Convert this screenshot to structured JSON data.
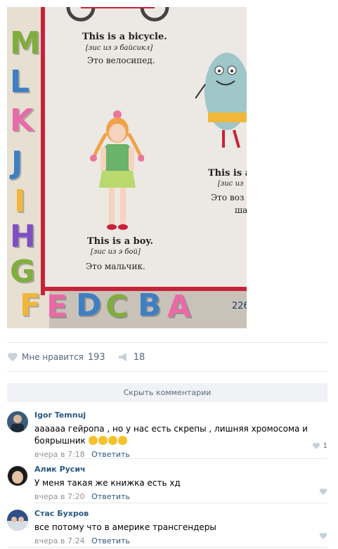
{
  "photo": {
    "caption_top_en": "This is a bicycle.",
    "caption_top_tr": "[зис из э байсикл]",
    "caption_top_ru": "Это велосипед.",
    "caption_mid_en": "This is a boy.",
    "caption_mid_tr": "[зис из э бой]",
    "caption_mid_ru": "Это мальчик.",
    "caption_right_en": "This is a",
    "caption_right_tr": "[зис из",
    "caption_right_ru1": "Это воз",
    "caption_right_ru2": "ша",
    "page_number": "226",
    "letters_left": [
      "M",
      "L",
      "K",
      "J",
      "I",
      "H",
      "G"
    ],
    "letters_bottom": [
      "F",
      "E",
      "D",
      "C",
      "B",
      "A"
    ]
  },
  "actions": {
    "like_label": "Мне нравится",
    "like_count": "193",
    "share_count": "18"
  },
  "hide_comments": "Скрыть комментарии",
  "comments": [
    {
      "author": "Igor Temnuj",
      "text": "аааааа гейропа , но у нас есть скрепы , лишняя хромосома и боярышник",
      "time": "вчера в 7:18",
      "reply": "Ответить",
      "likes": "1"
    },
    {
      "author": "Алик Русич",
      "text": "У меня такая же книжка есть хд",
      "time": "вчера в 7:20",
      "reply": "Ответить",
      "likes": ""
    },
    {
      "author": "Стас Бухров",
      "text": "все потому что в америке трансгендеры",
      "time": "вчера в 7:24",
      "reply": "Ответить",
      "likes": ""
    }
  ],
  "colors": {
    "link": "#2a5885",
    "meta": "#939393",
    "book_border": "#c8223a",
    "bar_bg": "#f0f2f5"
  }
}
